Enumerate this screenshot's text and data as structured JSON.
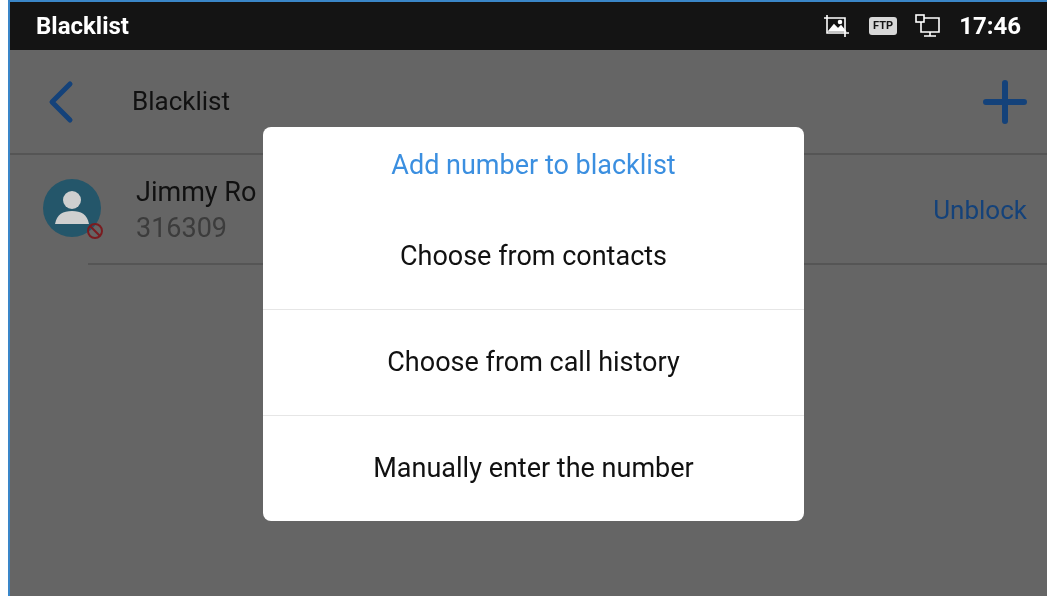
{
  "status_bar": {
    "title": "Blacklist",
    "badge": "FTP",
    "time": "17:46"
  },
  "app_bar": {
    "title": "Blacklist"
  },
  "contacts": [
    {
      "name": "Jimmy Ro",
      "number": "316309",
      "blocked": true,
      "action": "Unblock"
    }
  ],
  "dialog": {
    "title": "Add number to blacklist",
    "options": [
      "Choose from contacts",
      "Choose from call history",
      "Manually enter the number"
    ]
  }
}
